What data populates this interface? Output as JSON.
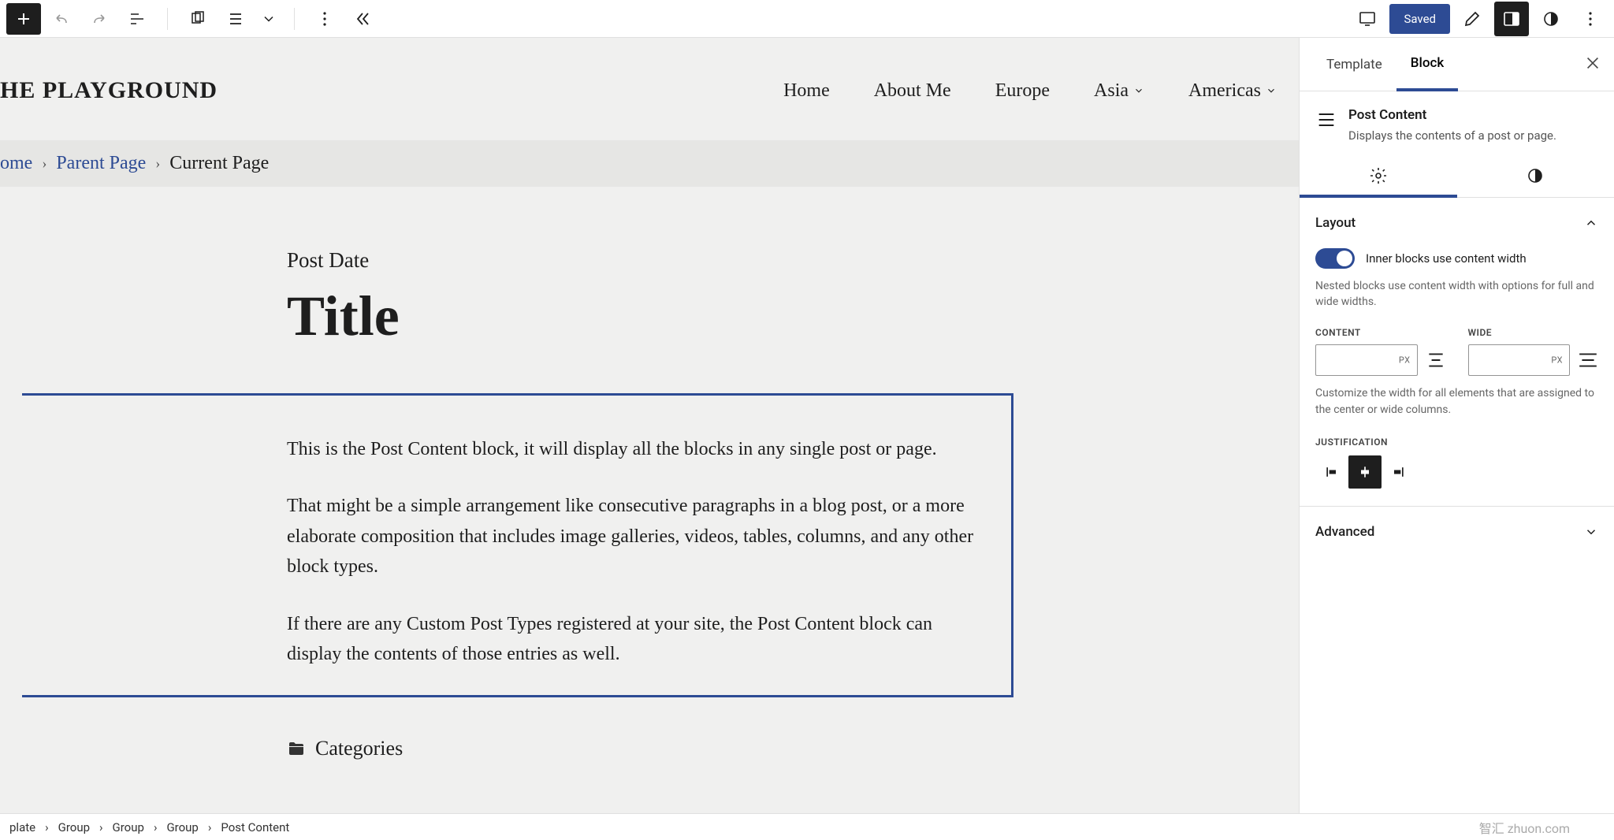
{
  "topbar": {
    "saved_label": "Saved"
  },
  "site": {
    "title": "HE PLAYGROUND"
  },
  "nav": {
    "items": [
      {
        "label": "Home",
        "submenu": false
      },
      {
        "label": "About Me",
        "submenu": false
      },
      {
        "label": "Europe",
        "submenu": false
      },
      {
        "label": "Asia",
        "submenu": true
      },
      {
        "label": "Americas",
        "submenu": true
      }
    ]
  },
  "page_breadcrumb": {
    "home": "ome",
    "parent": "Parent Page",
    "current": "Current Page"
  },
  "post": {
    "date_label": "Post Date",
    "title": "Title",
    "paragraphs": [
      "This is the Post Content block, it will display all the blocks in any single post or page.",
      "That might be a simple arrangement like consecutive paragraphs in a blog post, or a more elaborate composition that includes image galleries, videos, tables, columns, and any other block types.",
      "If there are any Custom Post Types registered at your site, the Post Content block can display the contents of those entries as well."
    ],
    "categories_label": "Categories"
  },
  "inspector": {
    "tabs": {
      "template": "Template",
      "block": "Block"
    },
    "block": {
      "name": "Post Content",
      "description": "Displays the contents of a post or page."
    },
    "layout": {
      "heading": "Layout",
      "toggle_label": "Inner blocks use content width",
      "toggle_help": "Nested blocks use content width with options for full and wide widths.",
      "content_label": "CONTENT",
      "wide_label": "WIDE",
      "unit": "PX",
      "width_help": "Customize the width for all elements that are assigned to the center or wide columns.",
      "justification_label": "JUSTIFICATION"
    },
    "advanced": "Advanced"
  },
  "footer": {
    "crumbs": [
      "plate",
      "Group",
      "Group",
      "Group",
      "Post Content"
    ]
  },
  "watermark": "智汇 zhuon.com"
}
